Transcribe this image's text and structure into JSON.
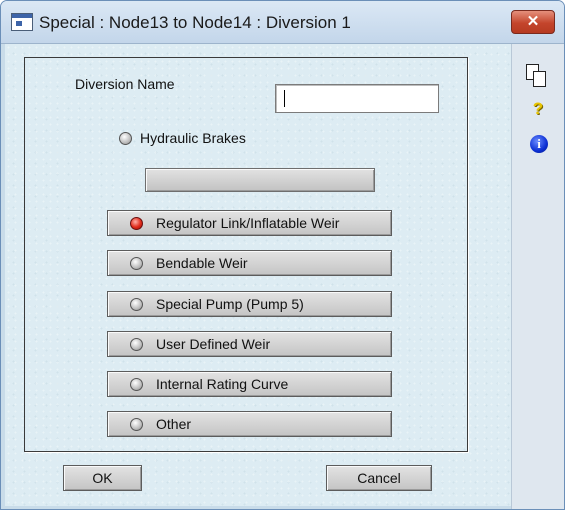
{
  "window": {
    "title": "Special : Node13 to Node14 : Diversion 1",
    "close_glyph": "✕"
  },
  "form": {
    "diversion_name_label": "Diversion Name",
    "diversion_name_value": "",
    "hydraulic_brakes_label": "Hydraulic Brakes"
  },
  "options": [
    {
      "label": "Regulator Link/Inflatable Weir",
      "selected": true
    },
    {
      "label": "Bendable Weir",
      "selected": false
    },
    {
      "label": "Special Pump (Pump 5)",
      "selected": false
    },
    {
      "label": "User Defined Weir",
      "selected": false
    },
    {
      "label": "Internal Rating Curve",
      "selected": false
    },
    {
      "label": "Other",
      "selected": false
    }
  ],
  "buttons": {
    "ok": "OK",
    "cancel": "Cancel"
  },
  "toolbar": {
    "help_glyph": "?",
    "info_glyph": "i",
    "icons": [
      "copy-icon",
      "help-icon",
      "info-icon"
    ]
  },
  "colors": {
    "selected_radio": "#e02a1a",
    "client_background": "#ddecf3",
    "close_button": "#c4452c"
  }
}
